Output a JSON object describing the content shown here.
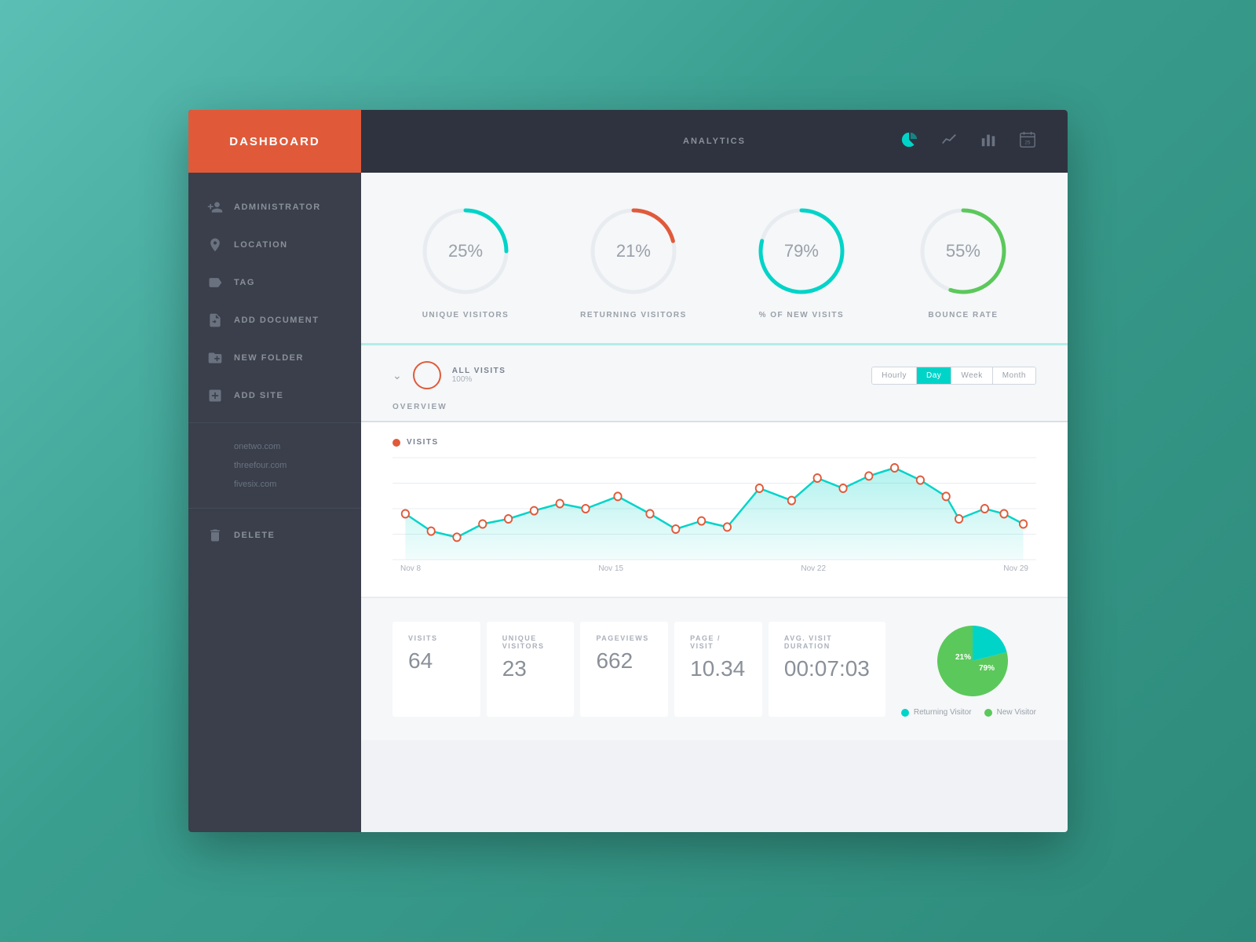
{
  "sidebar": {
    "title": "DASHBOARD",
    "items": [
      {
        "id": "administrator",
        "label": "ADMINISTRATOR"
      },
      {
        "id": "location",
        "label": "LOCATION"
      },
      {
        "id": "tag",
        "label": "TAG"
      },
      {
        "id": "add-document",
        "label": "ADD DOCUMENT"
      },
      {
        "id": "new-folder",
        "label": "NEW FOLDER"
      },
      {
        "id": "add-site",
        "label": "ADD SITE"
      },
      {
        "id": "delete",
        "label": "DELETE"
      }
    ],
    "sites": [
      "onetwo.com",
      "threefour.com",
      "fivesix.com"
    ]
  },
  "topbar": {
    "title": "ANALYTICS"
  },
  "metrics": [
    {
      "label": "UNIQUE VISITORS",
      "value": "25%",
      "pct": 25,
      "color": "#00d4c8"
    },
    {
      "label": "RETURNING VISITORS",
      "value": "21%",
      "pct": 21,
      "color": "#e05a3a"
    },
    {
      "label": "% OF NEW VISITS",
      "value": "79%",
      "pct": 79,
      "color": "#00d4c8"
    },
    {
      "label": "BOUNCE RATE",
      "value": "55%",
      "pct": 55,
      "color": "#5bc85b"
    }
  ],
  "overview": {
    "label": "ALL VISITS",
    "pct": "100%",
    "title": "OVERVIEW"
  },
  "time_filters": [
    "Hourly",
    "Day",
    "Week",
    "Month"
  ],
  "active_filter": "Day",
  "chart": {
    "label": "VISITS",
    "axis_labels": [
      "Nov 8",
      "Nov 15",
      "Nov 22",
      "Nov 29"
    ]
  },
  "stats": [
    {
      "label": "VISITS",
      "value": "64"
    },
    {
      "label": "UNIQUE VISITORS",
      "value": "23"
    },
    {
      "label": "PAGEVIEWS",
      "value": "662"
    },
    {
      "label": "PAGE / VISIT",
      "value": "10.34"
    },
    {
      "label": "AVG. VISIT DURATION",
      "value": "00:07:03"
    }
  ],
  "pie_chart": {
    "returning_pct": 21,
    "new_pct": 79,
    "returning_label": "Returning Visitor",
    "new_label": "New Visitor",
    "returning_color": "#00d4c8",
    "new_color": "#5bc85b",
    "returning_value": "21",
    "new_value": "79"
  }
}
